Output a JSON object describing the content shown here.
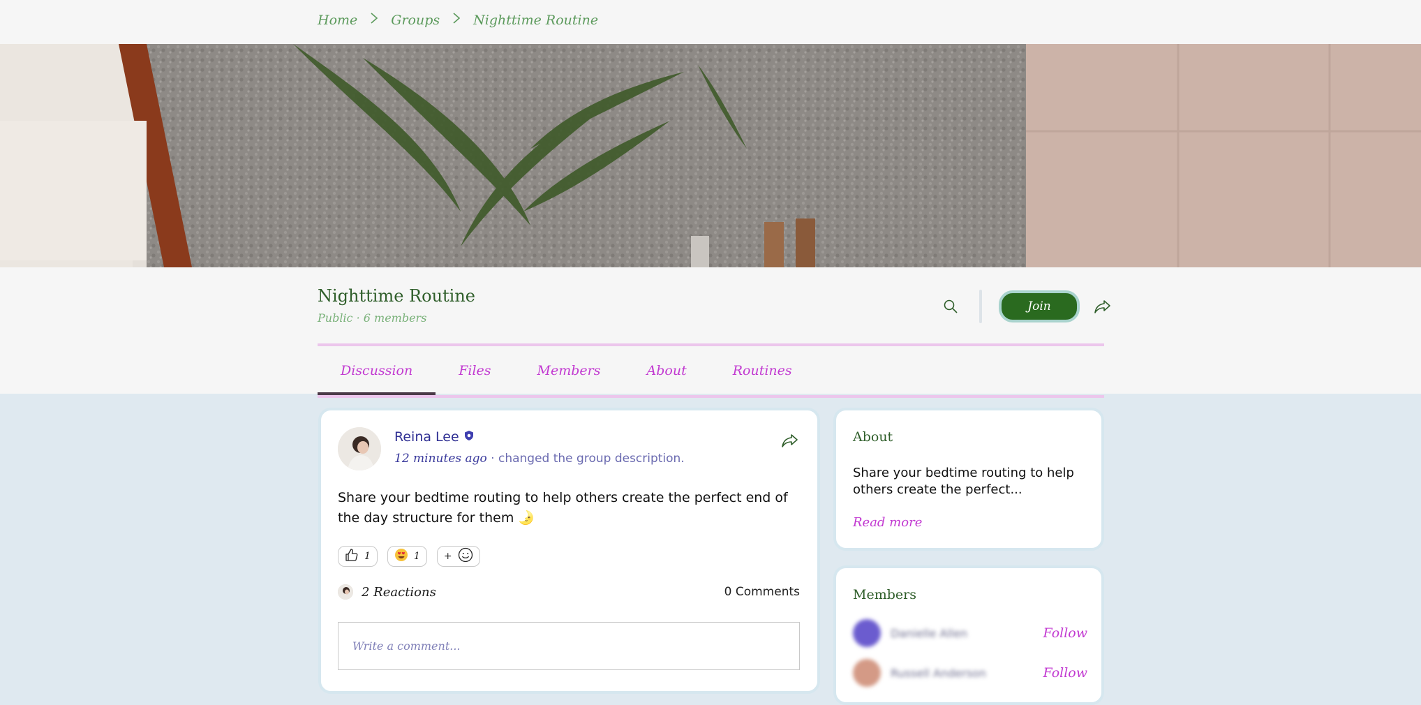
{
  "breadcrumb": {
    "items": [
      "Home",
      "Groups",
      "Nighttime Routine"
    ]
  },
  "group": {
    "title": "Nighttime Routine",
    "meta": "Public · 6 members",
    "join_label": "Join"
  },
  "tabs": [
    "Discussion",
    "Files",
    "Members",
    "About",
    "Routines"
  ],
  "post": {
    "author": "Reina Lee",
    "time": "12 minutes ago",
    "action": " · changed the group description.",
    "body": "Share your bedtime routing to help others create the perfect end of the day structure for them 🌛",
    "reactions": [
      {
        "emoji": "thumbs-up-icon",
        "count": "1"
      },
      {
        "emoji": "heart-eyes-emoji",
        "count": "1"
      }
    ],
    "add_reaction_label": "+",
    "reactions_summary": "2 Reactions",
    "comments_summary": "0 Comments",
    "comment_placeholder": "Write a comment..."
  },
  "about": {
    "title": "About",
    "text": "Share your bedtime routing to help others create the perfect...",
    "read_more": "Read more"
  },
  "members": {
    "title": "Members",
    "follow_label": "Follow",
    "items": [
      {
        "name": "Danielle Allen",
        "avatar_color": "#6b5ccf"
      },
      {
        "name": "Russell Anderson",
        "avatar_color": "#d49a86"
      }
    ]
  },
  "colors": {
    "accent_green": "#2a6a1f",
    "tab_pink": "#c23ad1",
    "background": "#dfe9f0"
  }
}
